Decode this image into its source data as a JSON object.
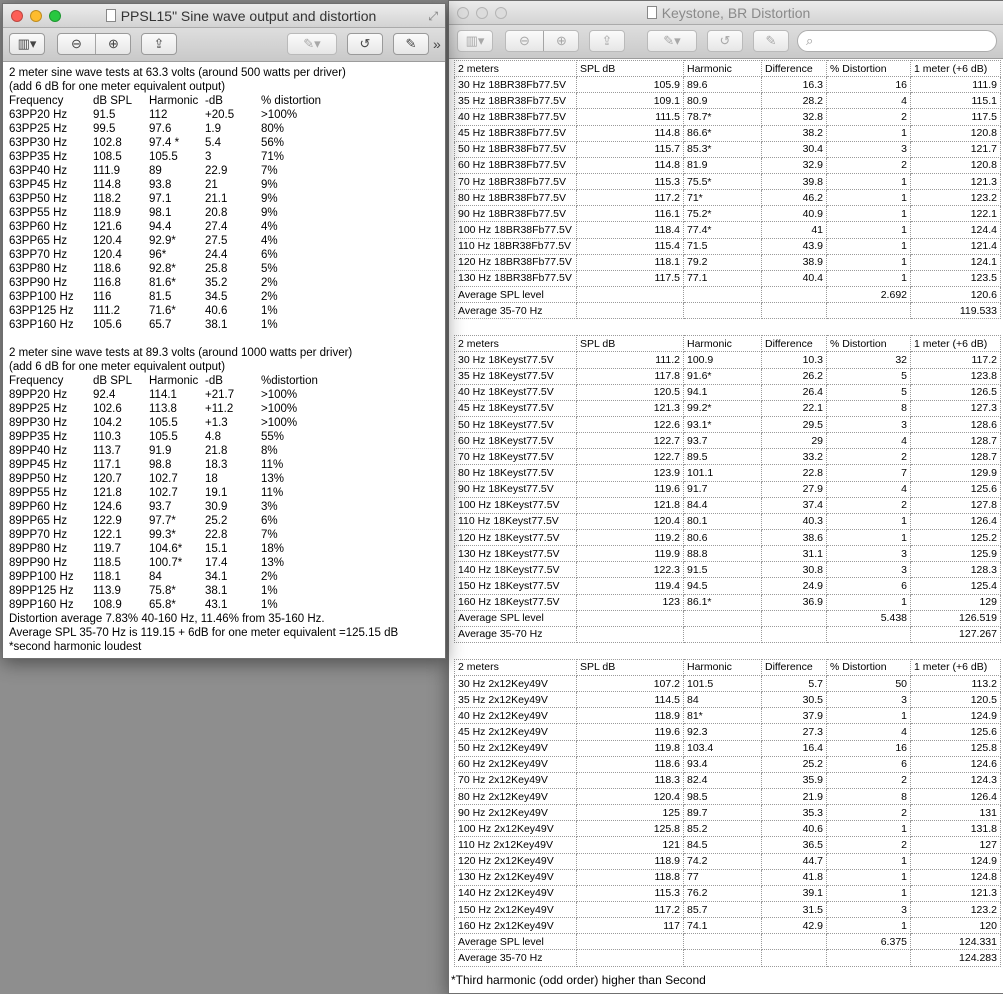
{
  "left_window": {
    "title": "PPSL15\" Sine wave output and distortion",
    "toolbar": {
      "sidebar": "▥",
      "zoom_out": "−",
      "zoom_in": "+",
      "share": "⇪",
      "annotate": "✎",
      "rotate": "↺",
      "edit": "✎",
      "more": "»"
    },
    "block1": {
      "heading1": "2 meter sine wave tests at 63.3 volts (around 500 watts per driver)",
      "heading2": "(add 6 dB for one meter equivalent output)",
      "columns": [
        "Frequency",
        "dB SPL",
        "Harmonic",
        "-dB",
        "% distortion"
      ],
      "rows": [
        [
          "63PP20 Hz",
          "91.5",
          "112",
          "+20.5",
          ">100%"
        ],
        [
          "63PP25 Hz",
          "99.5",
          "97.6",
          "1.9",
          "80%"
        ],
        [
          "63PP30 Hz",
          "102.8",
          "97.4 *",
          "5.4",
          "56%"
        ],
        [
          "63PP35 Hz",
          "108.5",
          "105.5",
          "3",
          "71%"
        ],
        [
          "63PP40 Hz",
          "111.9",
          "89",
          "22.9",
          "7%"
        ],
        [
          "63PP45 Hz",
          "114.8",
          "93.8",
          "21",
          "9%"
        ],
        [
          "63PP50 Hz",
          "118.2",
          "97.1",
          "21.1",
          "9%"
        ],
        [
          "63PP55 Hz",
          "118.9",
          "98.1",
          "20.8",
          "9%"
        ],
        [
          "63PP60 Hz",
          "121.6",
          "94.4",
          "27.4",
          "4%"
        ],
        [
          "63PP65 Hz",
          "120.4",
          "92.9*",
          "27.5",
          "4%"
        ],
        [
          "63PP70 Hz",
          "120.4",
          "96*",
          "24.4",
          "6%"
        ],
        [
          "63PP80 Hz",
          "118.6",
          "92.8*",
          "25.8",
          "5%"
        ],
        [
          "63PP90 Hz",
          "116.8",
          "81.6*",
          "35.2",
          "2%"
        ],
        [
          "63PP100 Hz",
          "116",
          "81.5",
          "34.5",
          "2%"
        ],
        [
          "63PP125 Hz",
          "111.2",
          "71.6*",
          "40.6",
          "1%"
        ],
        [
          "63PP160 Hz",
          "105.6",
          "65.7",
          "38.1",
          "1%"
        ]
      ]
    },
    "block2": {
      "heading1": "2 meter sine wave tests at 89.3 volts (around 1000 watts per driver)",
      "heading2": "(add 6 dB for one meter equivalent output)",
      "columns": [
        "Frequency",
        "dB SPL",
        "Harmonic",
        "-dB",
        "%distortion"
      ],
      "rows": [
        [
          "89PP20 Hz",
          "92.4",
          "114.1",
          "+21.7",
          ">100%"
        ],
        [
          "89PP25 Hz",
          "102.6",
          "113.8",
          "+11.2",
          ">100%"
        ],
        [
          "89PP30 Hz",
          "104.2",
          "105.5",
          "+1.3",
          ">100%"
        ],
        [
          "89PP35 Hz",
          "110.3",
          "105.5",
          "4.8",
          "55%"
        ],
        [
          "89PP40 Hz",
          "113.7",
          "91.9",
          "21.8",
          "8%"
        ],
        [
          "89PP45 Hz",
          "117.1",
          "98.8",
          "18.3",
          "11%"
        ],
        [
          "89PP50 Hz",
          "120.7",
          "102.7",
          "18",
          "13%"
        ],
        [
          "89PP55 Hz",
          "121.8",
          "102.7",
          "19.1",
          "11%"
        ],
        [
          "89PP60 Hz",
          "124.6",
          "93.7",
          "30.9",
          "3%"
        ],
        [
          "89PP65 Hz",
          "122.9",
          "97.7*",
          "25.2",
          "6%"
        ],
        [
          "89PP70 Hz",
          "122.1",
          "99.3*",
          "22.8",
          "7%"
        ],
        [
          "89PP80 Hz",
          "119.7",
          "104.6*",
          "15.1",
          "18%"
        ],
        [
          "89PP90 Hz",
          "118.5",
          "100.7*",
          "17.4",
          "13%"
        ],
        [
          "89PP100 Hz",
          "118.1",
          "84",
          "34.1",
          "2%"
        ],
        [
          "89PP125 Hz",
          "113.9",
          "75.8*",
          "38.1",
          "1%"
        ],
        [
          "89PP160 Hz",
          "108.9",
          "65.8*",
          "43.1",
          "1%"
        ]
      ]
    },
    "footer": [
      "Distortion average  7.83% 40-160 Hz, 11.46% from 35-160 Hz.",
      "Average SPL 35-70 Hz is 119.15 + 6dB for one meter equivalent =125.15 dB",
      "*second harmonic loudest"
    ]
  },
  "right_window": {
    "title": "Keystone, BR Distortion",
    "search_placeholder": "",
    "header": [
      "2 meters",
      "SPL dB",
      "Harmonic",
      "Difference",
      "% Distortion",
      "1 meter (+6 dB)"
    ],
    "sections": [
      {
        "rows": [
          [
            "30 Hz 18BR38Fb77.5V",
            "105.9",
            "89.6",
            "16.3",
            "16",
            "111.9"
          ],
          [
            "35 Hz 18BR38Fb77.5V",
            "109.1",
            "80.9",
            "28.2",
            "4",
            "115.1"
          ],
          [
            "40 Hz 18BR38Fb77.5V",
            "111.5",
            "78.7*",
            "32.8",
            "2",
            "117.5"
          ],
          [
            "45 Hz 18BR38Fb77.5V",
            "114.8",
            "86.6*",
            "38.2",
            "1",
            "120.8"
          ],
          [
            "50 Hz 18BR38Fb77.5V",
            "115.7",
            "85.3*",
            "30.4",
            "3",
            "121.7"
          ],
          [
            "60 Hz 18BR38Fb77.5V",
            "114.8",
            "81.9",
            "32.9",
            "2",
            "120.8"
          ],
          [
            "70 Hz 18BR38Fb77.5V",
            "115.3",
            "75.5*",
            "39.8",
            "1",
            "121.3"
          ],
          [
            "80 Hz 18BR38Fb77.5V",
            "117.2",
            "71*",
            "46.2",
            "1",
            "123.2"
          ],
          [
            "90 Hz 18BR38Fb77.5V",
            "116.1",
            "75.2*",
            "40.9",
            "1",
            "122.1"
          ],
          [
            "100 Hz 18BR38Fb77.5V",
            "118.4",
            "77.4*",
            "41",
            "1",
            "124.4"
          ],
          [
            "110 Hz 18BR38Fb77.5V",
            "115.4",
            "71.5",
            "43.9",
            "1",
            "121.4"
          ],
          [
            "120 Hz 18BR38Fb77.5V",
            "118.1",
            "79.2",
            "38.9",
            "1",
            "124.1"
          ],
          [
            "130 Hz 18BR38Fb77.5V",
            "117.5",
            "77.1",
            "40.4",
            "1",
            "123.5"
          ]
        ],
        "avg_spl": [
          "Average SPL level",
          "",
          "",
          "",
          "2.692",
          "120.6"
        ],
        "avg_range": [
          "Average 35-70 Hz",
          "",
          "",
          "",
          "",
          "119.533"
        ]
      },
      {
        "rows": [
          [
            "30 Hz 18Keyst77.5V",
            "111.2",
            "100.9",
            "10.3",
            "32",
            "117.2"
          ],
          [
            "35 Hz 18Keyst77.5V",
            "117.8",
            "91.6*",
            "26.2",
            "5",
            "123.8"
          ],
          [
            "40 Hz 18Keyst77.5V",
            "120.5",
            "94.1",
            "26.4",
            "5",
            "126.5"
          ],
          [
            "45 Hz 18Keyst77.5V",
            "121.3",
            "99.2*",
            "22.1",
            "8",
            "127.3"
          ],
          [
            "50 Hz 18Keyst77.5V",
            "122.6",
            "93.1*",
            "29.5",
            "3",
            "128.6"
          ],
          [
            "60 Hz 18Keyst77.5V",
            "122.7",
            "93.7",
            "29",
            "4",
            "128.7"
          ],
          [
            "70 Hz 18Keyst77.5V",
            "122.7",
            "89.5",
            "33.2",
            "2",
            "128.7"
          ],
          [
            "80 Hz 18Keyst77.5V",
            "123.9",
            "101.1",
            "22.8",
            "7",
            "129.9"
          ],
          [
            "90 Hz 18Keyst77.5V",
            "119.6",
            "91.7",
            "27.9",
            "4",
            "125.6"
          ],
          [
            "100 Hz 18Keyst77.5V",
            "121.8",
            "84.4",
            "37.4",
            "2",
            "127.8"
          ],
          [
            "110 Hz 18Keyst77.5V",
            "120.4",
            "80.1",
            "40.3",
            "1",
            "126.4"
          ],
          [
            "120 Hz 18Keyst77.5V",
            "119.2",
            "80.6",
            "38.6",
            "1",
            "125.2"
          ],
          [
            "130 Hz 18Keyst77.5V",
            "119.9",
            "88.8",
            "31.1",
            "3",
            "125.9"
          ],
          [
            "140 Hz 18Keyst77.5V",
            "122.3",
            "91.5",
            "30.8",
            "3",
            "128.3"
          ],
          [
            "150 Hz 18Keyst77.5V",
            "119.4",
            "94.5",
            "24.9",
            "6",
            "125.4"
          ],
          [
            "160 Hz 18Keyst77.5V",
            "123",
            "86.1*",
            "36.9",
            "1",
            "129"
          ]
        ],
        "avg_spl": [
          "Average SPL level",
          "",
          "",
          "",
          "5.438",
          "126.519"
        ],
        "avg_range": [
          "Average 35-70 Hz",
          "",
          "",
          "",
          "",
          "127.267"
        ]
      },
      {
        "rows": [
          [
            "30 Hz 2x12Key49V",
            "107.2",
            "101.5",
            "5.7",
            "50",
            "113.2"
          ],
          [
            "35 Hz 2x12Key49V",
            "114.5",
            "84",
            "30.5",
            "3",
            "120.5"
          ],
          [
            "40 Hz 2x12Key49V",
            "118.9",
            "81*",
            "37.9",
            "1",
            "124.9"
          ],
          [
            "45 Hz 2x12Key49V",
            "119.6",
            "92.3",
            "27.3",
            "4",
            "125.6"
          ],
          [
            "50 Hz 2x12Key49V",
            "119.8",
            "103.4",
            "16.4",
            "16",
            "125.8"
          ],
          [
            "60 Hz 2x12Key49V",
            "118.6",
            "93.4",
            "25.2",
            "6",
            "124.6"
          ],
          [
            "70 Hz 2x12Key49V",
            "118.3",
            "82.4",
            "35.9",
            "2",
            "124.3"
          ],
          [
            "80 Hz 2x12Key49V",
            "120.4",
            "98.5",
            "21.9",
            "8",
            "126.4"
          ],
          [
            "90 Hz 2x12Key49V",
            "125",
            "89.7",
            "35.3",
            "2",
            "131"
          ],
          [
            "100 Hz 2x12Key49V",
            "125.8",
            "85.2",
            "40.6",
            "1",
            "131.8"
          ],
          [
            "110 Hz 2x12Key49V",
            "121",
            "84.5",
            "36.5",
            "2",
            "127"
          ],
          [
            "120 Hz 2x12Key49V",
            "118.9",
            "74.2",
            "44.7",
            "1",
            "124.9"
          ],
          [
            "130 Hz 2x12Key49V",
            "118.8",
            "77",
            "41.8",
            "1",
            "124.8"
          ],
          [
            "140 Hz 2x12Key49V",
            "115.3",
            "76.2",
            "39.1",
            "1",
            "121.3"
          ],
          [
            "150 Hz 2x12Key49V",
            "117.2",
            "85.7",
            "31.5",
            "3",
            "123.2"
          ],
          [
            "160 Hz 2x12Key49V",
            "117",
            "74.1",
            "42.9",
            "1",
            "120"
          ]
        ],
        "avg_spl": [
          "Average SPL level",
          "",
          "",
          "",
          "6.375",
          "124.331"
        ],
        "avg_range": [
          "Average 35-70 Hz",
          "",
          "",
          "",
          "",
          "124.283"
        ]
      }
    ],
    "footnote": "*Third harmonic (odd order) higher than Second"
  }
}
